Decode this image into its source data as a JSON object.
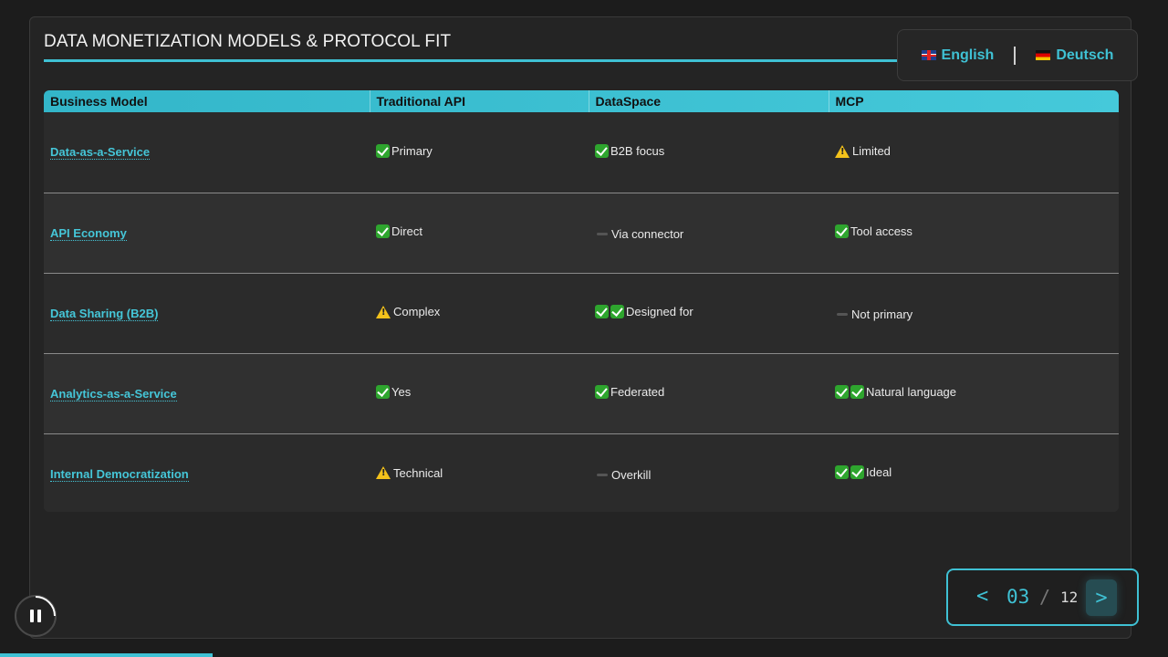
{
  "slide": {
    "title": "DATA MONETIZATION MODELS & PROTOCOL FIT"
  },
  "language": {
    "options": [
      {
        "label": "English",
        "flag": "uk-flag-icon"
      },
      {
        "label": "Deutsch",
        "flag": "de-flag-icon"
      }
    ]
  },
  "table": {
    "headers": [
      "Business Model",
      "Traditional API",
      "DataSpace",
      "MCP"
    ],
    "rows": [
      {
        "model": "Data-as-a-Service",
        "cells": [
          {
            "icon": "check",
            "text": "Primary"
          },
          {
            "icon": "check",
            "text": "B2B focus"
          },
          {
            "icon": "warning",
            "text": "Limited"
          }
        ]
      },
      {
        "model": "API Economy",
        "cells": [
          {
            "icon": "check",
            "text": "Direct"
          },
          {
            "icon": "dash",
            "text": "Via connector"
          },
          {
            "icon": "check",
            "text": "Tool access"
          }
        ]
      },
      {
        "model": "Data Sharing (B2B)",
        "cells": [
          {
            "icon": "warning",
            "text": "Complex"
          },
          {
            "icon": "double-check",
            "text": "Designed for"
          },
          {
            "icon": "dash",
            "text": "Not primary"
          }
        ]
      },
      {
        "model": "Analytics-as-a-Service",
        "cells": [
          {
            "icon": "check",
            "text": "Yes"
          },
          {
            "icon": "check",
            "text": "Federated"
          },
          {
            "icon": "double-check",
            "text": "Natural language"
          }
        ]
      },
      {
        "model": "Internal Democratization",
        "cells": [
          {
            "icon": "warning",
            "text": "Technical"
          },
          {
            "icon": "dash",
            "text": "Overkill"
          },
          {
            "icon": "double-check",
            "text": "Ideal"
          }
        ]
      }
    ]
  },
  "pager": {
    "prev_label": "<",
    "current": "03",
    "separator": "/",
    "total": "12",
    "next_label": ">"
  },
  "progress": {
    "fraction": 0.182
  },
  "colors": {
    "accent": "#3fc1d4",
    "check": "#2ea52e",
    "warning": "#f4c21b"
  }
}
